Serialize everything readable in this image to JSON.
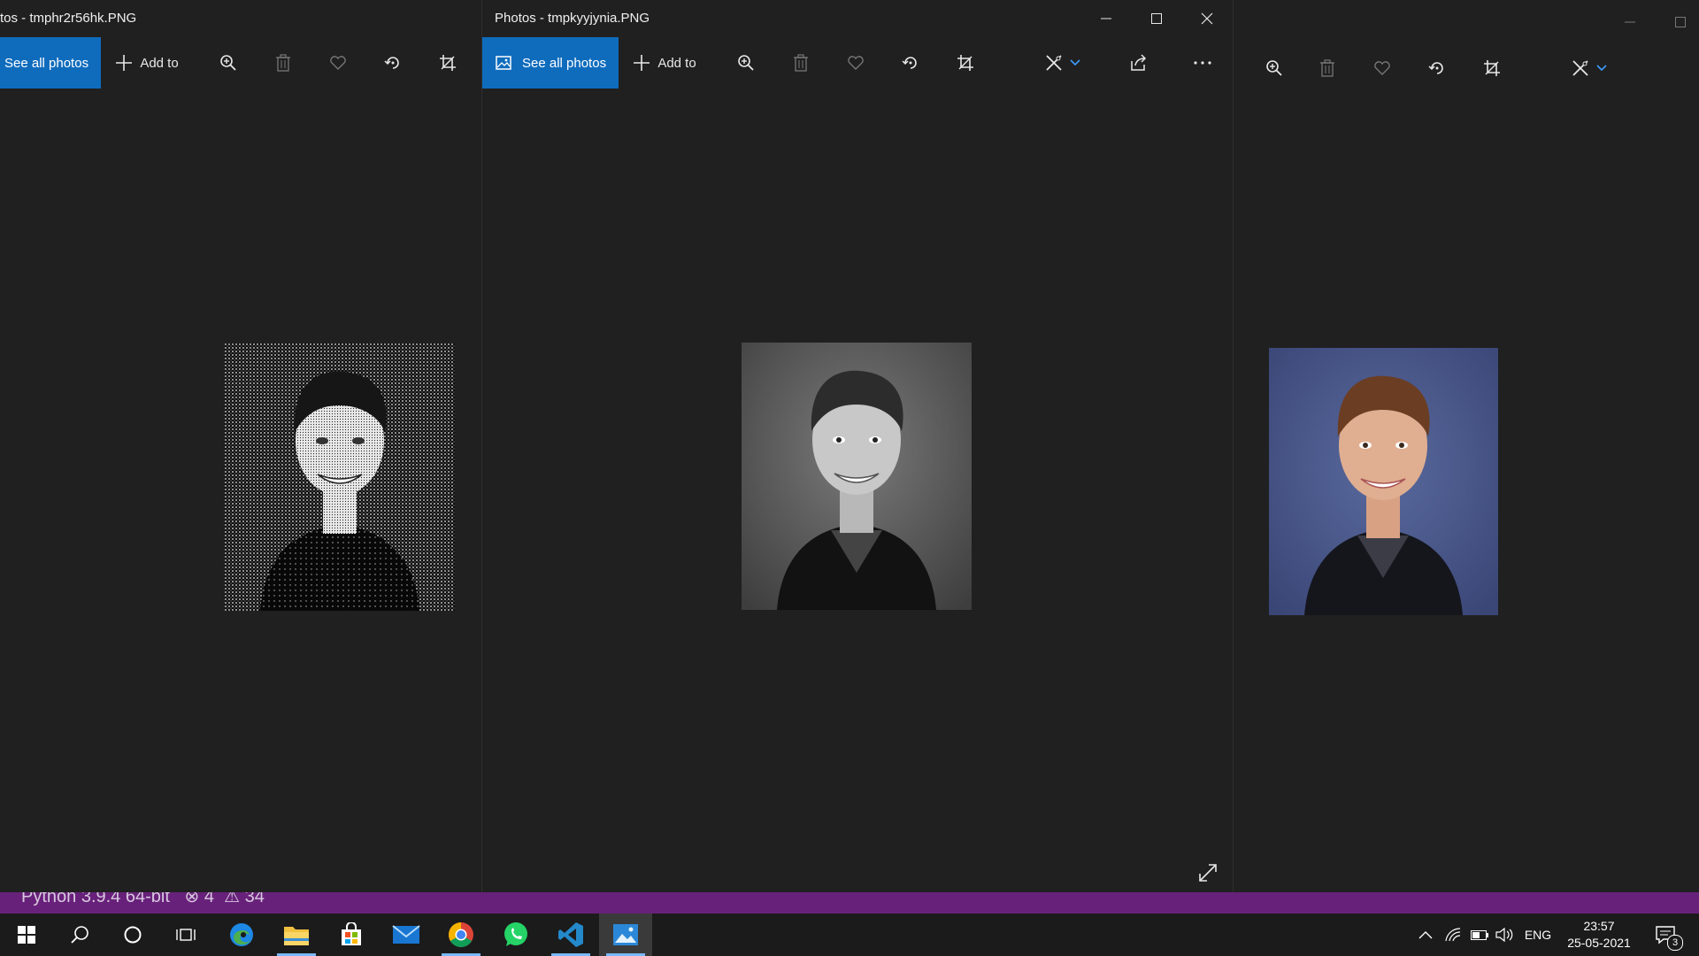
{
  "windows": {
    "left": {
      "title": "tos - tmphr2r56hk.PNG",
      "see_all": "See all photos",
      "add_to": "Add to"
    },
    "middle": {
      "title": "Photos - tmpkyyjynia.PNG",
      "see_all": "See all photos",
      "add_to": "Add to"
    },
    "right": {}
  },
  "status_bar": {
    "text": "Python 3.9.4 64-bit   ⊗ 4  ⚠ 34"
  },
  "taskbar": {
    "apps": [
      "start-icon",
      "search-icon",
      "cortana-icon",
      "task-view-icon",
      "edge-icon",
      "file-explorer-icon",
      "store-icon",
      "mail-icon",
      "chrome-icon",
      "whatsapp-icon",
      "vscode-icon",
      "photos-icon"
    ],
    "language": "ENG",
    "time": "23:57",
    "date": "25-05-2021",
    "notification_count": "3"
  },
  "colors": {
    "accent": "#0f6cbd",
    "background": "#202020",
    "taskbar": "#1b1b1b",
    "statusbar": "#68217a"
  }
}
